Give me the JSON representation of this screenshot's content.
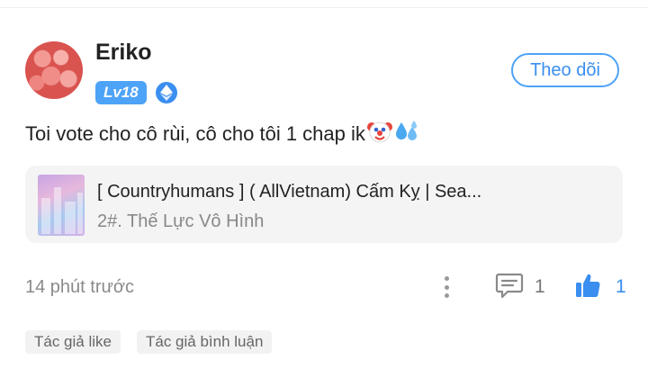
{
  "comment": {
    "user": {
      "name": "Eriko",
      "level": "Lv18",
      "rank_icon": "ethereum-badge-icon"
    },
    "follow_label": "Theo dõi",
    "text": "Toi vote cho cô rùi, cô cho tôi 1 chap ik",
    "emojis": [
      "clown-face",
      "sweat-droplets"
    ],
    "story": {
      "title": "[ Countryhumans ] ( AllVietnam) Cấm Kỵ | Sea...",
      "chapter": "2#. Thế Lực Vô Hình"
    },
    "time": "14 phút trước",
    "reply_count": "1",
    "like_count": "1",
    "tags": [
      "Tác giả like",
      "Tác giả bình luận"
    ]
  },
  "colors": {
    "accent": "#3a8ef0",
    "level_badge": "#4da3f7",
    "secondary_text": "#8a8a8a",
    "card_bg": "#f4f4f4"
  }
}
